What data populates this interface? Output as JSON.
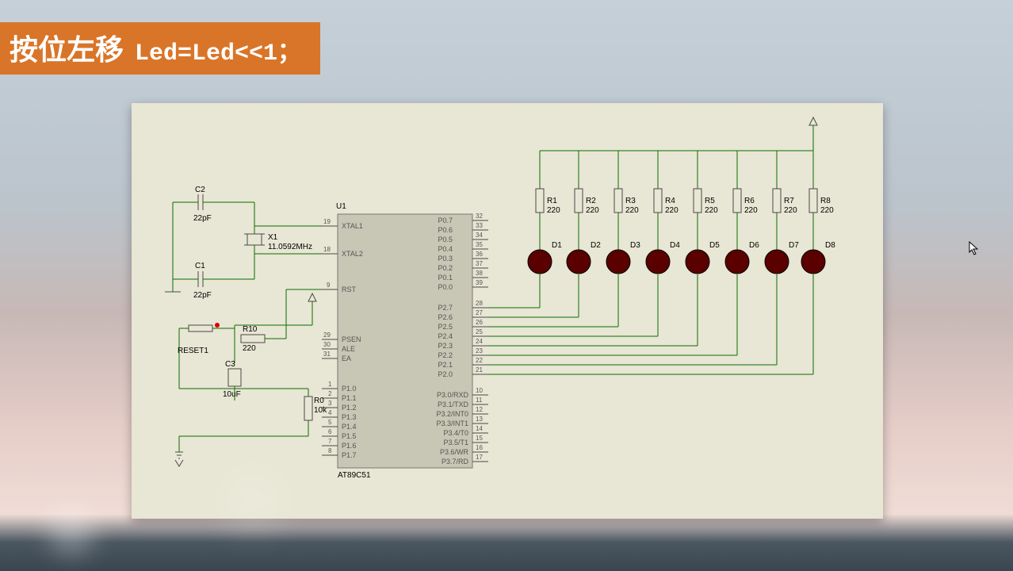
{
  "title": {
    "main": "按位左移",
    "code": "Led=Led<<1；"
  },
  "chip": {
    "ref": "U1",
    "part": "AT89C51",
    "left_pins": [
      {
        "n": "19",
        "name": "XTAL1"
      },
      {
        "n": "18",
        "name": "XTAL2"
      },
      {
        "n": "9",
        "name": "RST"
      },
      {
        "n": "29",
        "name": "PSEN"
      },
      {
        "n": "30",
        "name": "ALE"
      },
      {
        "n": "31",
        "name": "EA"
      },
      {
        "n": "1",
        "name": "P1.0"
      },
      {
        "n": "2",
        "name": "P1.1"
      },
      {
        "n": "3",
        "name": "P1.2"
      },
      {
        "n": "4",
        "name": "P1.3"
      },
      {
        "n": "5",
        "name": "P1.4"
      },
      {
        "n": "6",
        "name": "P1.5"
      },
      {
        "n": "7",
        "name": "P1.6"
      },
      {
        "n": "8",
        "name": "P1.7"
      }
    ],
    "right_pins": [
      {
        "n": "32",
        "name": "P0.7"
      },
      {
        "n": "33",
        "name": "P0.6"
      },
      {
        "n": "34",
        "name": "P0.5"
      },
      {
        "n": "35",
        "name": "P0.4"
      },
      {
        "n": "36",
        "name": "P0.3"
      },
      {
        "n": "37",
        "name": "P0.2"
      },
      {
        "n": "38",
        "name": "P0.1"
      },
      {
        "n": "39",
        "name": "P0.0"
      },
      {
        "n": "28",
        "name": "P2.7"
      },
      {
        "n": "27",
        "name": "P2.6"
      },
      {
        "n": "26",
        "name": "P2.5"
      },
      {
        "n": "25",
        "name": "P2.4"
      },
      {
        "n": "24",
        "name": "P2.3"
      },
      {
        "n": "23",
        "name": "P2.2"
      },
      {
        "n": "22",
        "name": "P2.1"
      },
      {
        "n": "21",
        "name": "P2.0"
      },
      {
        "n": "10",
        "name": "P3.0/RXD"
      },
      {
        "n": "11",
        "name": "P3.1/TXD"
      },
      {
        "n": "12",
        "name": "P3.2/INT0"
      },
      {
        "n": "13",
        "name": "P3.3/INT1"
      },
      {
        "n": "14",
        "name": "P3.4/T0"
      },
      {
        "n": "15",
        "name": "P3.5/T1"
      },
      {
        "n": "16",
        "name": "P3.6/WR"
      },
      {
        "n": "17",
        "name": "P3.7/RD"
      }
    ]
  },
  "caps": [
    {
      "ref": "C2",
      "val": "22pF"
    },
    {
      "ref": "C1",
      "val": "22pF"
    },
    {
      "ref": "C3",
      "val": "10uF"
    }
  ],
  "xtal": {
    "ref": "X1",
    "val": "11.0592MHz"
  },
  "resistors": [
    {
      "ref": "R10",
      "val": "220"
    },
    {
      "ref": "R0",
      "val": "10k"
    }
  ],
  "led_res": [
    {
      "ref": "R1",
      "val": "220"
    },
    {
      "ref": "R2",
      "val": "220"
    },
    {
      "ref": "R3",
      "val": "220"
    },
    {
      "ref": "R4",
      "val": "220"
    },
    {
      "ref": "R5",
      "val": "220"
    },
    {
      "ref": "R6",
      "val": "220"
    },
    {
      "ref": "R7",
      "val": "220"
    },
    {
      "ref": "R8",
      "val": "220"
    }
  ],
  "leds": [
    {
      "ref": "D1"
    },
    {
      "ref": "D2"
    },
    {
      "ref": "D3"
    },
    {
      "ref": "D4"
    },
    {
      "ref": "D5"
    },
    {
      "ref": "D6"
    },
    {
      "ref": "D7"
    },
    {
      "ref": "D8"
    }
  ],
  "reset": {
    "ref": "RESET1"
  }
}
